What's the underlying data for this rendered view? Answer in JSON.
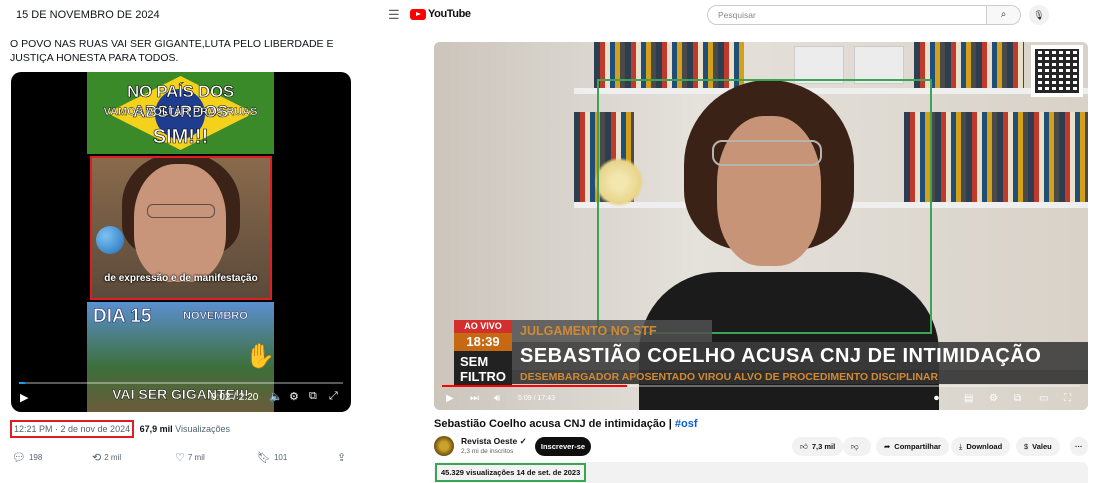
{
  "tweet": {
    "date_header": "15 DE NOVEMBRO DE 2024",
    "text": "O POVO NAS RUAS VAI SER GIGANTE,LUTA PELO LIBERDADE E JUSTIÇA HONESTA PARA TODOS.",
    "video": {
      "banner_line1": "NO PAÍS DOS ABSURDOS",
      "banner_line2": "VAMOS VOLTAR PRAS RUAS",
      "banner_line3": "SIM!!!",
      "caption": "de expressão e de manifestação",
      "dia": "DIA 15",
      "novembro": "NOVEMBRO",
      "bottom_text": "VAI SER GIGANTE!!!",
      "time": "0:02 / 2:20",
      "progress": 0.02,
      "icons": [
        "play-icon",
        "volume-icon",
        "settings-icon",
        "pip-icon",
        "fullscreen-icon"
      ]
    },
    "timestamp": "12:21 PM · 2 de nov de 2024",
    "views_count": "67,9 mil",
    "views_label": "Visualizações",
    "actions": {
      "replies": "198",
      "reposts": "2 mil",
      "likes": "7 mil",
      "bookmarks": "101"
    },
    "highlight_color": "#e11d24"
  },
  "youtube": {
    "logo_text": "YouTube",
    "search_placeholder": "Pesquisar",
    "player": {
      "live_badge": "AO VIVO",
      "time_badge": "18:39",
      "show_name": "SEM FILTRO",
      "topic": "JULGAMENTO NO STF",
      "headline": "SEBASTIÃO COELHO ACUSA CNJ DE INTIMIDAÇÃO",
      "subheadline": "DESEMBARGADOR APOSENTADO VIROU ALVO DE PROCEDIMENTO DISCIPLINAR",
      "time": "5:09 / 17:43",
      "progress": 0.29
    },
    "video_title": "Sebastião Coelho acusa CNJ de intimidação | ",
    "video_title_tag": "#osf",
    "channel_name": "Revista Oeste",
    "channel_subs": "2,3 mi de inscritos",
    "subscribe_label": "Inscrever-se",
    "likes": "7,3 mil",
    "share_label": "Compartilhar",
    "download_label": "Download",
    "thanks_label": "Valeu",
    "more_label": "···",
    "views_date": "45.329 visualizações  14 de set. de 2023",
    "highlight_color": "#3aa655"
  }
}
